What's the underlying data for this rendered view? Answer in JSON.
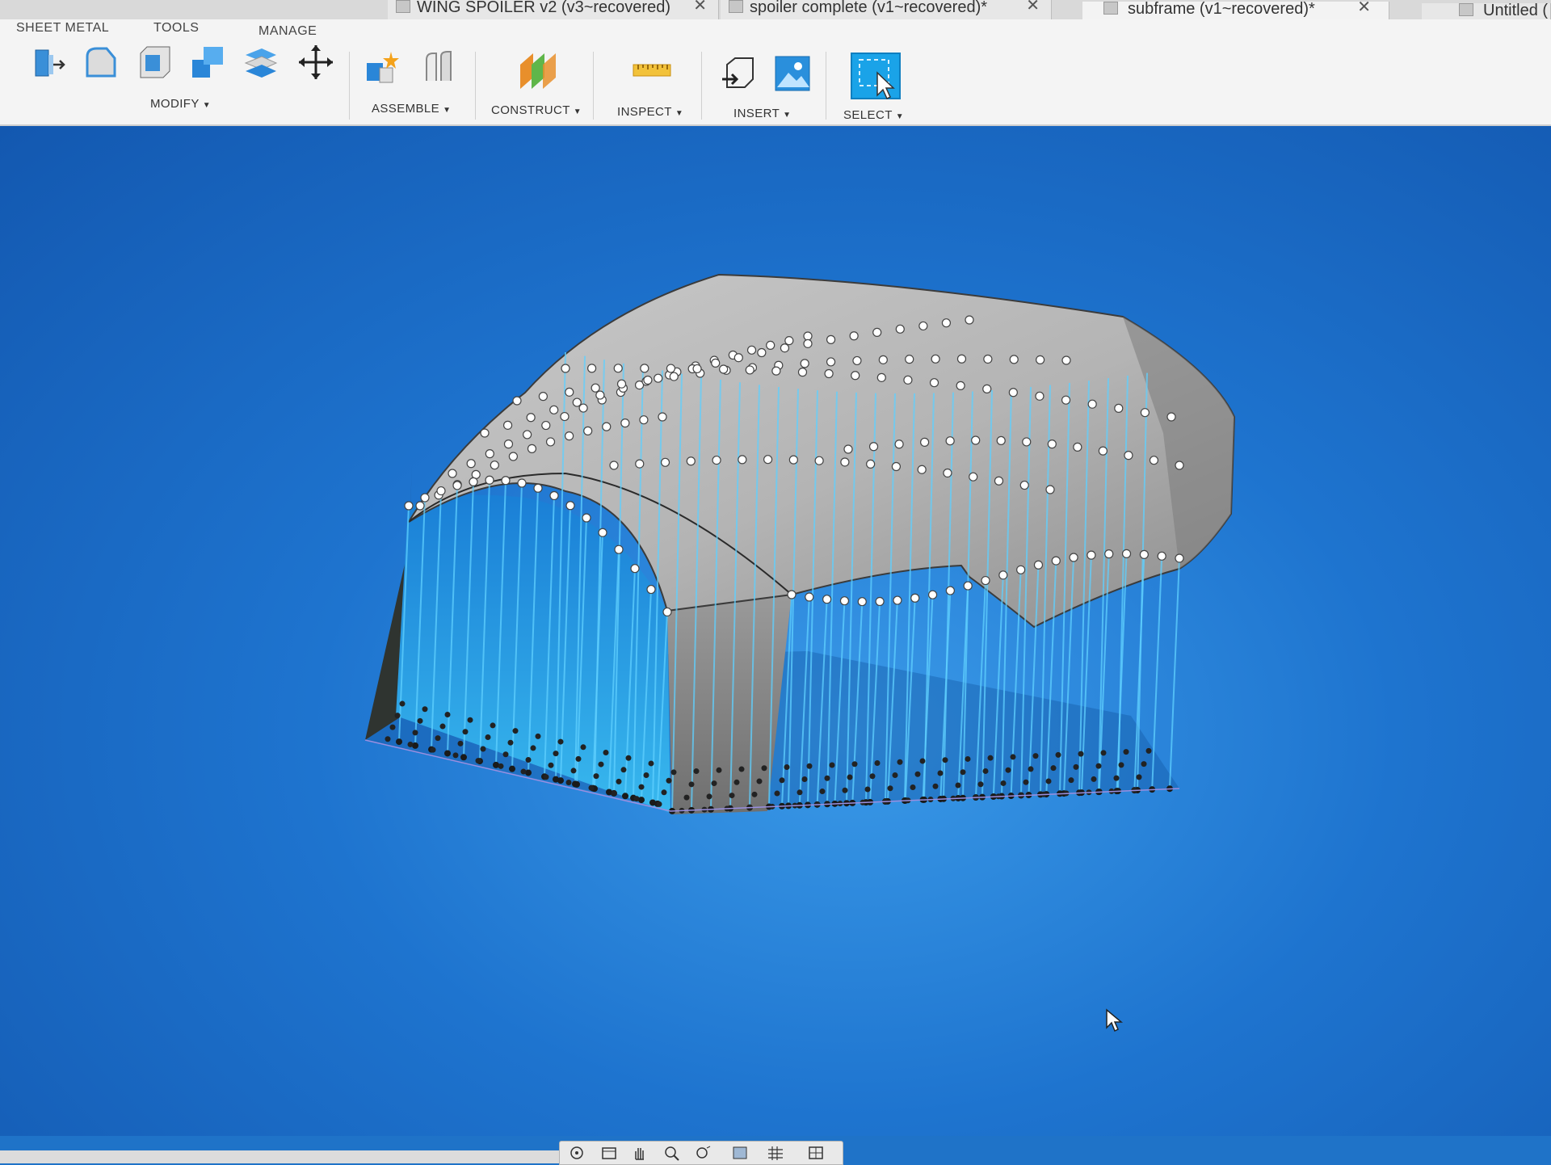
{
  "tabs": [
    {
      "label": "WING SPOILER v2 (v3~recovered)",
      "active": false
    },
    {
      "label": "spoiler complete (v1~recovered)*",
      "active": false
    },
    {
      "label": "subframe (v1~recovered)*",
      "active": true
    },
    {
      "label": "Untitled (",
      "active": false
    }
  ],
  "workspace_tabs": [
    "SHEET METAL",
    "TOOLS",
    "MANAGE"
  ],
  "groups": {
    "modify": "MODIFY",
    "assemble": "ASSEMBLE",
    "construct": "CONSTRUCT",
    "inspect": "INSPECT",
    "insert": "INSERT",
    "select": "SELECT"
  },
  "icons": {
    "modify": [
      "press-pull-icon",
      "fillet-icon",
      "shell-icon",
      "combine-icon",
      "offset-face-icon",
      "move-icon"
    ],
    "assemble": [
      "new-component-icon",
      "joint-icon"
    ],
    "construct": [
      "offset-plane-icon"
    ],
    "inspect": [
      "measure-icon"
    ],
    "insert": [
      "insert-derive-icon",
      "insert-image-icon"
    ],
    "select": [
      "select-window-icon"
    ],
    "nav": [
      "orbit-icon",
      "look-at-icon",
      "pan-icon",
      "zoom-icon",
      "fit-icon",
      "display-mode-icon",
      "grid-icon",
      "viewports-icon"
    ]
  },
  "colors": {
    "viewport_blue": "#1f73c8",
    "surface_gray": "#a9a9a9",
    "projection_cyan": "#5fd0ff",
    "select_accent": "#1aa3e8"
  }
}
